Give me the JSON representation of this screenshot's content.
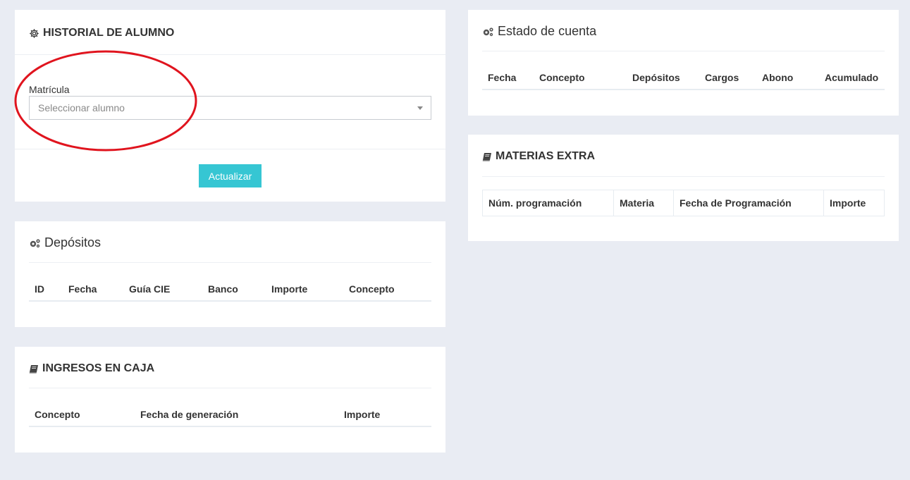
{
  "historial": {
    "title": "HISTORIAL DE ALUMNO",
    "field_label": "Matrícula",
    "select_placeholder": "Seleccionar alumno",
    "button_label": "Actualizar"
  },
  "depositos": {
    "title": "Depósitos",
    "columns": [
      "ID",
      "Fecha",
      "Guía CIE",
      "Banco",
      "Importe",
      "Concepto"
    ]
  },
  "ingresos": {
    "title": "INGRESOS EN CAJA",
    "columns": [
      "Concepto",
      "Fecha de generación",
      "Importe"
    ]
  },
  "estado": {
    "title": "Estado de cuenta",
    "columns": [
      "Fecha",
      "Concepto",
      "Depósitos",
      "Cargos",
      "Abono",
      "Acumulado"
    ]
  },
  "materias": {
    "title": "MATERIAS EXTRA",
    "columns": [
      "Núm. programación",
      "Materia",
      "Fecha de Programación",
      "Importe"
    ]
  },
  "colors": {
    "accent": "#36c6d3",
    "annotation": "#e0141e",
    "background": "#e9ecf3"
  },
  "icons": {
    "historial": "gear-icon",
    "depositos": "cogs-icon",
    "estado": "cogs-icon",
    "ingresos": "book-icon",
    "materias": "book-icon"
  }
}
